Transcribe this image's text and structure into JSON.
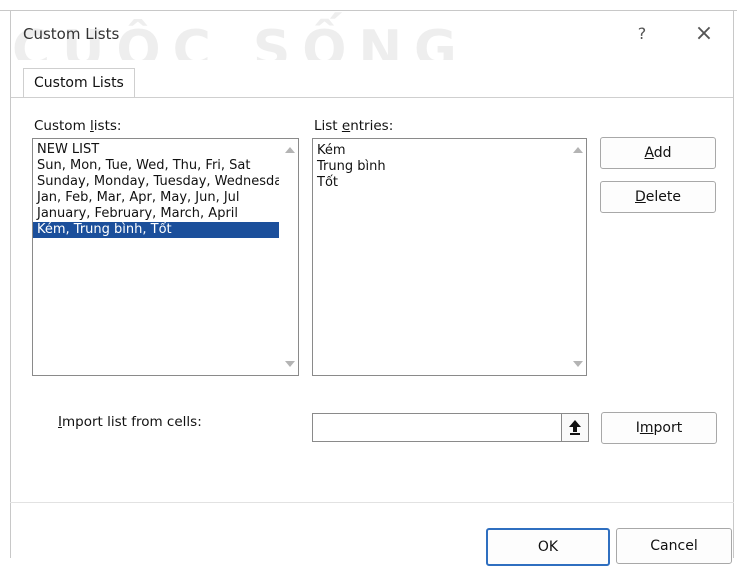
{
  "dialog": {
    "title": "Custom Lists",
    "help_glyph": "?",
    "close_glyph": "×"
  },
  "watermark": {
    "text": "CUỘC SỐNG"
  },
  "tab": {
    "label": "Custom Lists"
  },
  "custom_lists": {
    "label_pre": "Custom ",
    "label_ul": "l",
    "label_post": "ists:",
    "items": [
      "NEW LIST",
      "Sun, Mon, Tue, Wed, Thu, Fri, Sat",
      "Sunday, Monday, Tuesday, Wednesday",
      "Jan, Feb, Mar, Apr, May, Jun, Jul",
      "January, February, March, April",
      "Kém, Trung bình, Tốt"
    ],
    "selected_index": 5
  },
  "list_entries": {
    "label_pre": "List ",
    "label_ul": "e",
    "label_post": "ntries:",
    "items": [
      "Kém",
      "Trung bình",
      "Tốt"
    ]
  },
  "buttons": {
    "add_ul": "A",
    "add_rest": "dd",
    "delete_ul": "D",
    "delete_rest": "elete",
    "import_pre": "I",
    "import_ul": "m",
    "import_post": "port",
    "ok": "OK",
    "cancel": "Cancel"
  },
  "import_field": {
    "label_ul": "I",
    "label_rest": "mport list from cells:",
    "value": ""
  },
  "colors": {
    "selection": "#1b4f9b",
    "primary_border": "#2f6fc0"
  }
}
